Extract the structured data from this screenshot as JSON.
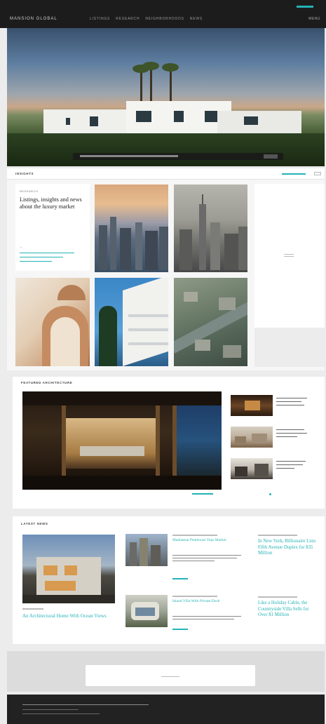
{
  "header": {
    "logo": "MANSION GLOBAL",
    "nav": [
      "LISTINGS",
      "RESEARCH",
      "NEIGHBORHOODS",
      "NEWS"
    ],
    "menu": "MENU"
  },
  "hero": {
    "caption": ""
  },
  "section_insights": {
    "title": "INSIGHTS",
    "subtitle": "",
    "intro_kicker": "RESEARCH",
    "intro_heading": "Listings, insights and news about the luxury market"
  },
  "featured": {
    "title": "FEATURED ARCHITECTURE"
  },
  "news": {
    "title": "LATEST NEWS",
    "main": {
      "headline": "An Architectural Home With Ocean Views"
    },
    "mid1": {
      "headline": "Manhattan Penthouse Tops Market"
    },
    "mid2": {
      "headline": "Island Villa With Private Dock"
    },
    "right1": {
      "headline": "In New York, Billionaire Lists Fifth Avenue Duplex for $35 Million"
    },
    "right2": {
      "headline": "Like a Holiday Cabin, the Countryside Villa Sells for Over $1 Million"
    }
  },
  "colors": {
    "accent": "#24b2b6",
    "topbar": "#1c1c1c",
    "footer": "#222222"
  }
}
